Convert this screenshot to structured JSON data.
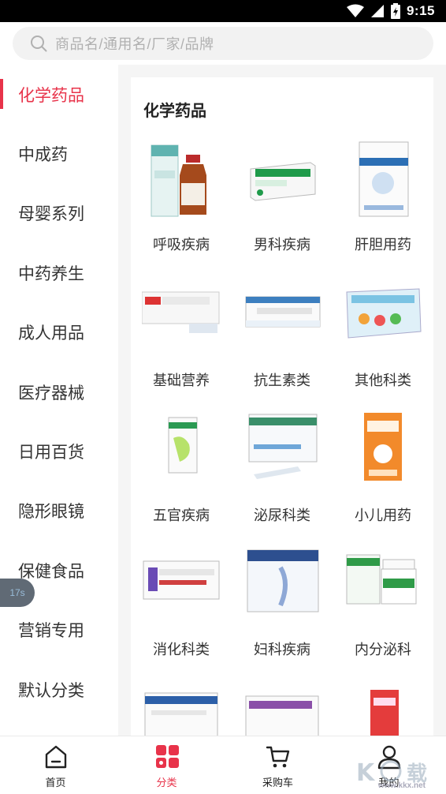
{
  "status_bar": {
    "time": "9:15",
    "icons": [
      "wifi-icon",
      "signal-icon",
      "battery-icon"
    ]
  },
  "search": {
    "placeholder": "商品名/通用名/厂家/品牌"
  },
  "sidebar": {
    "items": [
      {
        "label": "化学药品",
        "active": true
      },
      {
        "label": "中成药"
      },
      {
        "label": "母婴系列"
      },
      {
        "label": "中药养生"
      },
      {
        "label": "成人用品"
      },
      {
        "label": "医疗器械"
      },
      {
        "label": "日用百货"
      },
      {
        "label": "隐形眼镜"
      },
      {
        "label": "保健食品"
      },
      {
        "label": "营销专用"
      },
      {
        "label": "默认分类"
      }
    ]
  },
  "float_badge": "17s",
  "main": {
    "title": "化学药品",
    "categories": [
      {
        "label": "呼吸疾病"
      },
      {
        "label": "男科疾病"
      },
      {
        "label": "肝胆用药"
      },
      {
        "label": "基础营养"
      },
      {
        "label": "抗生素类"
      },
      {
        "label": "其他科类"
      },
      {
        "label": "五官疾病"
      },
      {
        "label": "泌尿科类"
      },
      {
        "label": "小儿用药"
      },
      {
        "label": "消化科类"
      },
      {
        "label": "妇科疾病"
      },
      {
        "label": "内分泌科"
      }
    ]
  },
  "bottom_nav": {
    "items": [
      {
        "label": "首页",
        "icon": "home-icon"
      },
      {
        "label": "分类",
        "icon": "category-icon",
        "active": true
      },
      {
        "label": "采购车",
        "icon": "cart-icon"
      },
      {
        "label": "我的",
        "icon": "user-icon"
      }
    ]
  },
  "watermark": "www.kkx.net",
  "colors": {
    "accent": "#e8334a",
    "background": "#f5f5f5"
  }
}
